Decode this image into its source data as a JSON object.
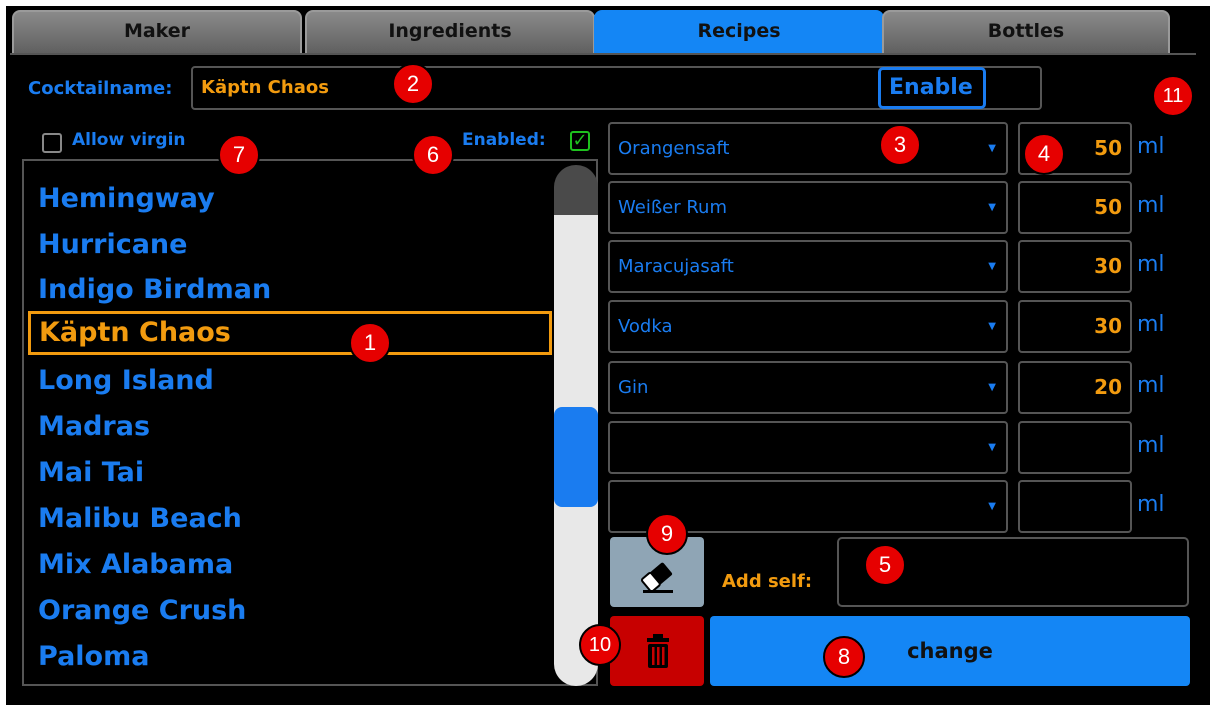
{
  "tabs": [
    {
      "label": "Maker"
    },
    {
      "label": "Ingredients"
    },
    {
      "label": "Recipes",
      "active": true
    },
    {
      "label": "Bottles"
    }
  ],
  "cocktail": {
    "name_label": "Cocktailname:",
    "name_value": "Käptn Chaos",
    "enable_label": "Enable",
    "allow_virgin_label": "Allow virgin",
    "enabled_label": "Enabled:",
    "enabled_checked": true
  },
  "cocktail_list": {
    "items": [
      "Hemingway",
      "Hurricane",
      "Indigo Birdman",
      "Käptn Chaos",
      "Long Island",
      "Madras",
      "Mai Tai",
      "Malibu Beach",
      "Mix Alabama",
      "Orange Crush",
      "Paloma"
    ],
    "selected": "Käptn Chaos"
  },
  "ingredients": [
    {
      "name": "Orangensaft",
      "amount": "50",
      "unit": "ml"
    },
    {
      "name": "Weißer Rum",
      "amount": "50",
      "unit": "ml"
    },
    {
      "name": "Maracujasaft",
      "amount": "30",
      "unit": "ml"
    },
    {
      "name": "Vodka",
      "amount": "30",
      "unit": "ml"
    },
    {
      "name": "Gin",
      "amount": "20",
      "unit": "ml"
    },
    {
      "name": "",
      "amount": "",
      "unit": "ml"
    },
    {
      "name": "",
      "amount": "",
      "unit": "ml"
    }
  ],
  "actions": {
    "add_self_label": "Add self:",
    "add_self_value": "",
    "change_label": "change"
  },
  "callouts": [
    "1",
    "2",
    "3",
    "4",
    "5",
    "6",
    "7",
    "8",
    "9",
    "10",
    "11"
  ],
  "colors": {
    "accent_blue": "#1a7cf0",
    "accent_orange": "#f29b0f",
    "delete_red": "#c70000"
  }
}
